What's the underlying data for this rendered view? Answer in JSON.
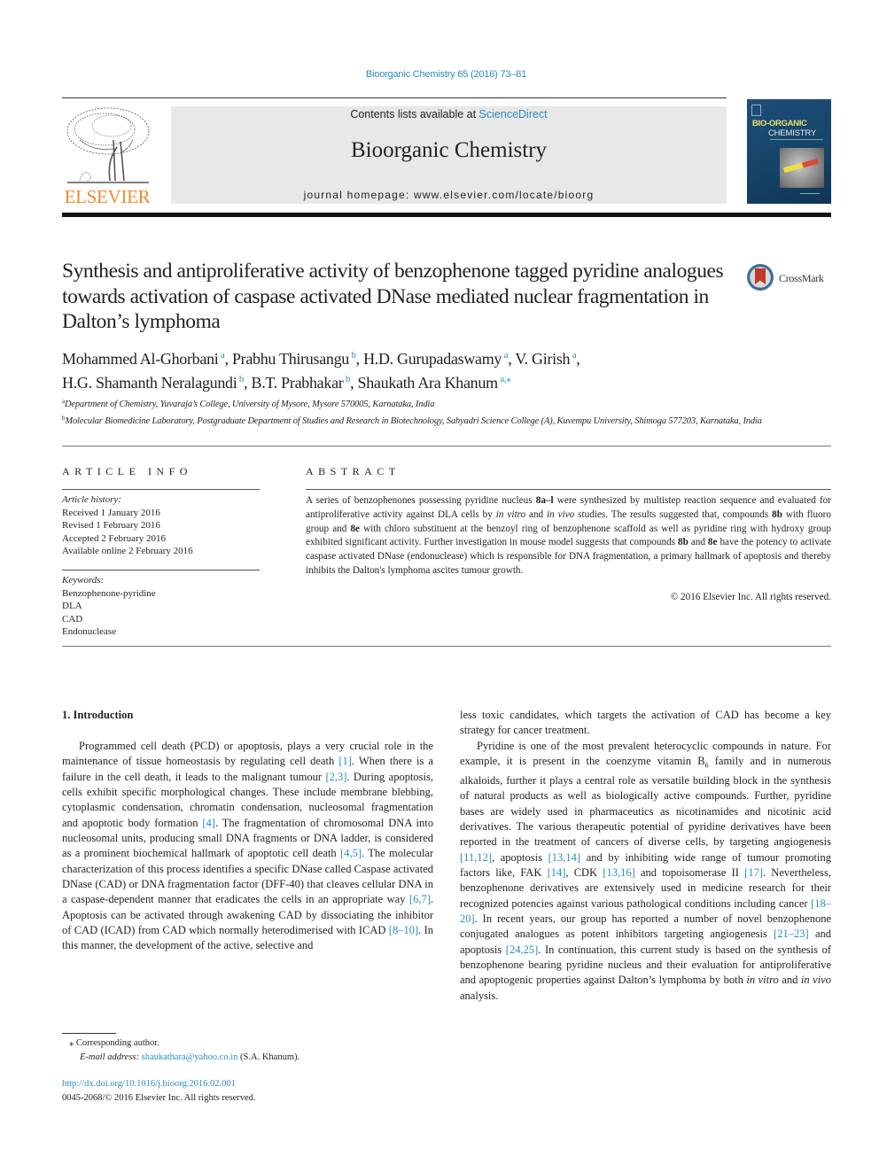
{
  "header": {
    "citation": "Bioorganic Chemistry 65 (2016) 73–81",
    "contents_prefix": "Contents lists available at ",
    "contents_link": "ScienceDirect",
    "journal_name": "Bioorganic Chemistry",
    "homepage_prefix": "journal homepage: ",
    "homepage_url": "www.elsevier.com/locate/bioorg",
    "publisher_logo_text": "ELSEVIER",
    "cover_title_line1": "BIO-ORGANIC",
    "cover_title_line2": "CHEMISTRY",
    "crossmark_label": "CrossMark"
  },
  "article": {
    "title": "Synthesis and antiproliferative activity of benzophenone tagged pyridine analogues towards activation of caspase activated DNase mediated nuclear fragmentation in Dalton’s lymphoma",
    "authors": [
      {
        "name": "Mohammed Al-Ghorbani",
        "aff": "a",
        "sep": ", "
      },
      {
        "name": "Prabhu Thirusangu",
        "aff": "b",
        "sep": ", "
      },
      {
        "name": "H.D. Gurupadaswamy",
        "aff": "a",
        "sep": ", "
      },
      {
        "name": "V. Girish",
        "aff": "a",
        "sep": ","
      },
      {
        "name": "H.G. Shamanth Neralagundi",
        "aff": "b",
        "sep": ", "
      },
      {
        "name": "B.T. Prabhakar",
        "aff": "b",
        "sep": ", "
      },
      {
        "name": "Shaukath Ara Khanum",
        "aff": "a,⁎",
        "sep": ""
      }
    ],
    "affiliations": [
      {
        "mark": "a",
        "text": "Department of Chemistry, Yuvaraja’s College, University of Mysore, Mysore 570005, Karnataka, India"
      },
      {
        "mark": "b",
        "text": "Molecular Biomedicine Laboratory, Postgraduate Department of Studies and Research in Biotechnology, Sahyadri Science College (A), Kuvempu University, Shimoga 577203, Karnataka, India"
      }
    ]
  },
  "article_info": {
    "heading": "ARTICLE INFO",
    "history_label": "Article history:",
    "history": [
      "Received 1 January 2016",
      "Revised 1 February 2016",
      "Accepted 2 February 2016",
      "Available online 2 February 2016"
    ],
    "keywords_label": "Keywords:",
    "keywords": [
      "Benzophenone-pyridine",
      "DLA",
      "CAD",
      "Endonuclease"
    ]
  },
  "abstract": {
    "heading": "ABSTRACT",
    "segments": [
      {
        "t": "A series of benzophenones possessing pyridine nucleus "
      },
      {
        "t": "8a–l",
        "b": true
      },
      {
        "t": " were synthesized by multistep reaction sequence and evaluated for antiproliferative activity against DLA cells by "
      },
      {
        "t": "in vitro",
        "i": true
      },
      {
        "t": " and "
      },
      {
        "t": "in vivo",
        "i": true
      },
      {
        "t": " studies. The results suggested that, compounds "
      },
      {
        "t": "8b",
        "b": true
      },
      {
        "t": " with fluoro group and "
      },
      {
        "t": "8e",
        "b": true
      },
      {
        "t": " with chloro substituent at the benzoyl ring of benzophenone scaffold as well as pyridine ring with hydroxy group exhibited significant activity. Further investigation in mouse model suggests that compounds "
      },
      {
        "t": "8b",
        "b": true
      },
      {
        "t": " and "
      },
      {
        "t": "8e",
        "b": true
      },
      {
        "t": " have the potency to activate caspase activated DNase (endonuclease) which is responsible for DNA fragmentation, a primary hallmark of apoptosis and thereby inhibits the Dalton's lymphoma ascites tumour growth."
      }
    ],
    "copyright": "© 2016 Elsevier Inc. All rights reserved."
  },
  "body": {
    "intro_heading": "1. Introduction",
    "left_paragraphs": [
      [
        {
          "t": "Programmed cell death (PCD) or apoptosis, plays a very crucial role in the maintenance of tissue homeostasis by regulating cell death "
        },
        {
          "t": "[1]",
          "r": true
        },
        {
          "t": ". When there is a failure in the cell death, it leads to the malignant tumour "
        },
        {
          "t": "[2,3]",
          "r": true
        },
        {
          "t": ". During apoptosis, cells exhibit specific morphological changes. These include membrane blebbing, cyto­plasmic condensation, chromatin condensation, nucleosomal frag­mentation and apoptotic body formation "
        },
        {
          "t": "[4]",
          "r": true
        },
        {
          "t": ". The fragmentation of chromosomal DNA into nucleosomal units, producing small DNA fragments or DNA ladder, is considered as a prominent biochemical hallmark of apoptotic cell death "
        },
        {
          "t": "[4,5]",
          "r": true
        },
        {
          "t": ". The molecular characteriza­tion of this process identifies a specific DNase called Caspase acti­vated DNase (CAD) or DNA fragmentation factor (DFF-40) that cleaves cellular DNA in a caspase-dependent manner that eradi­cates the cells in an appropriate way "
        },
        {
          "t": "[6,7]",
          "r": true
        },
        {
          "t": ". Apoptosis can be acti­vated through awakening CAD by dissociating the inhibitor of CAD (ICAD) from CAD which normally heterodimerised with ICAD "
        },
        {
          "t": "[8–10]",
          "r": true
        },
        {
          "t": ". In this manner, the development of the active, selective and"
        }
      ]
    ],
    "right_paragraphs": [
      [
        {
          "t": "less toxic candidates, which targets the activation of CAD has become a key strategy for cancer treatment."
        }
      ],
      [
        {
          "t": "Pyridine is one of the most prevalent heterocyclic compounds in nature. For example, it is present in the coenzyme vitamin B"
        },
        {
          "t": "6",
          "sub": true
        },
        {
          "t": " family and in numerous alkaloids, further it plays a central role as versatile building block in the synthesis of natural products as well as biologically active compounds. Further, pyridine bases are widely used in pharmaceutics as nicotinamides and nicotinic acid derivatives. The various therapeutic potential of pyridine derivatives have been reported in the treatment of cancers of diverse cells, by targeting angiogenesis "
        },
        {
          "t": "[11,12]",
          "r": true
        },
        {
          "t": ", apoptosis "
        },
        {
          "t": "[13,14]",
          "r": true
        },
        {
          "t": " and by inhibiting wide range of tumour promoting factors like, FAK "
        },
        {
          "t": "[14]",
          "r": true
        },
        {
          "t": ", CDK "
        },
        {
          "t": "[13,16]",
          "r": true
        },
        {
          "t": " and topoisomerase II "
        },
        {
          "t": "[17]",
          "r": true
        },
        {
          "t": ". Neverthe­less, benzophenone derivatives are extensively used in medicine research for their recognized potencies against various pathological conditions including cancer "
        },
        {
          "t": "[18–20]",
          "r": true
        },
        {
          "t": ". In recent years, our group has reported a number of novel benzophenone conjugated analogues as potent inhibitors targeting angiogenesis "
        },
        {
          "t": "[21–23]",
          "r": true
        },
        {
          "t": " and apoptosis "
        },
        {
          "t": "[24,25]",
          "r": true
        },
        {
          "t": ". In continuation, this current study is based on the synthesis of benzophenone bearing pyridine nucleus and their evaluation for antiproliferative and apoptogenic properties against Dalton’s lymphoma by both "
        },
        {
          "t": "in vitro",
          "i": true
        },
        {
          "t": " and "
        },
        {
          "t": "in vivo",
          "i": true
        },
        {
          "t": " analysis."
        }
      ]
    ]
  },
  "footer": {
    "corresponding_mark": "⁎",
    "corresponding_label": "Corresponding author.",
    "email_label": "E-mail address: ",
    "email": "shaukathara@yahoo.co.in",
    "email_suffix": " (S.A. Khanum).",
    "doi": "http://dx.doi.org/10.1016/j.bioorg.2016.02.001",
    "issn_copyright": "0045-2068/© 2016 Elsevier Inc. All rights reserved."
  },
  "colors": {
    "link": "#2a8cbf",
    "elsevier_orange": "#f08a2c",
    "banner_gray": "#e8e8e8",
    "text": "#231f20"
  }
}
